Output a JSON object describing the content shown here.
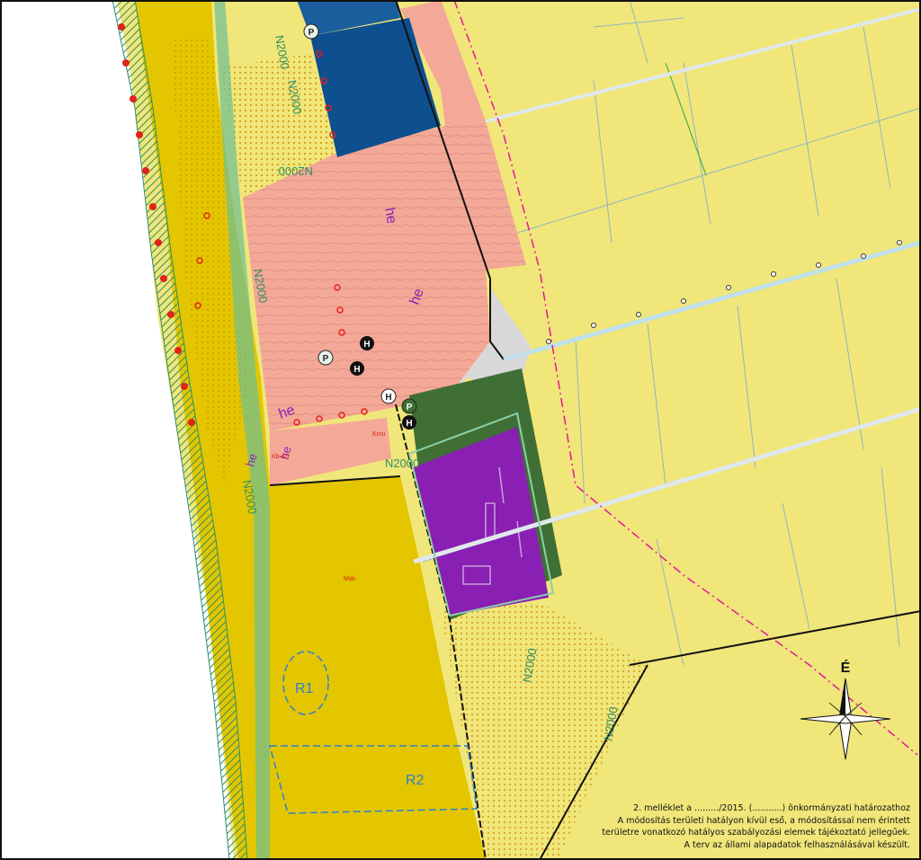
{
  "map": {
    "zone_labels": {
      "r1": "R1",
      "r2": "R2",
      "he_1": "he",
      "he_2": "he",
      "he_3": "he",
      "he_4": "he",
      "he_5": "he",
      "kb_szt": "Kb-szt",
      "kmu": "Kmü",
      "mak": "Mák",
      "road_1": "N2000",
      "road_2": "N2000",
      "road_3": "N2000",
      "road_4": "N2000",
      "road_5": "N2000",
      "road_6": "N2000",
      "road_7": "N2000",
      "road_8": "N2000"
    },
    "markers": {
      "p1": "P",
      "p2": "P",
      "p3": "P",
      "h1": "H",
      "h2": "H",
      "h3": "H",
      "h4": "H"
    },
    "north_arrow": {
      "label": "É"
    },
    "legend_note": {
      "line1": "2. melléklet a ........./2015. (...........) önkormányzati határozathoz",
      "line2": "A módosítás területi hatályon kívül eső, a módosítással nem érintett",
      "line3": "területre vonatkozó hatályos szabályozási elemek tájékoztató jellegűek.",
      "line4": "A terv az állami alapadatok felhasználásával készült."
    },
    "colors": {
      "agricultural": "#f0e67a",
      "forest_yellow": "#e3c600",
      "residential": "#f4a897",
      "blue_zone": "#0e4f8f",
      "purple_zone": "#8a1fb4",
      "green_zone": "#3f6f34",
      "green_strip": "#6cbf95",
      "red_line": "#e2231a",
      "magenta_line": "#e8149b"
    }
  }
}
